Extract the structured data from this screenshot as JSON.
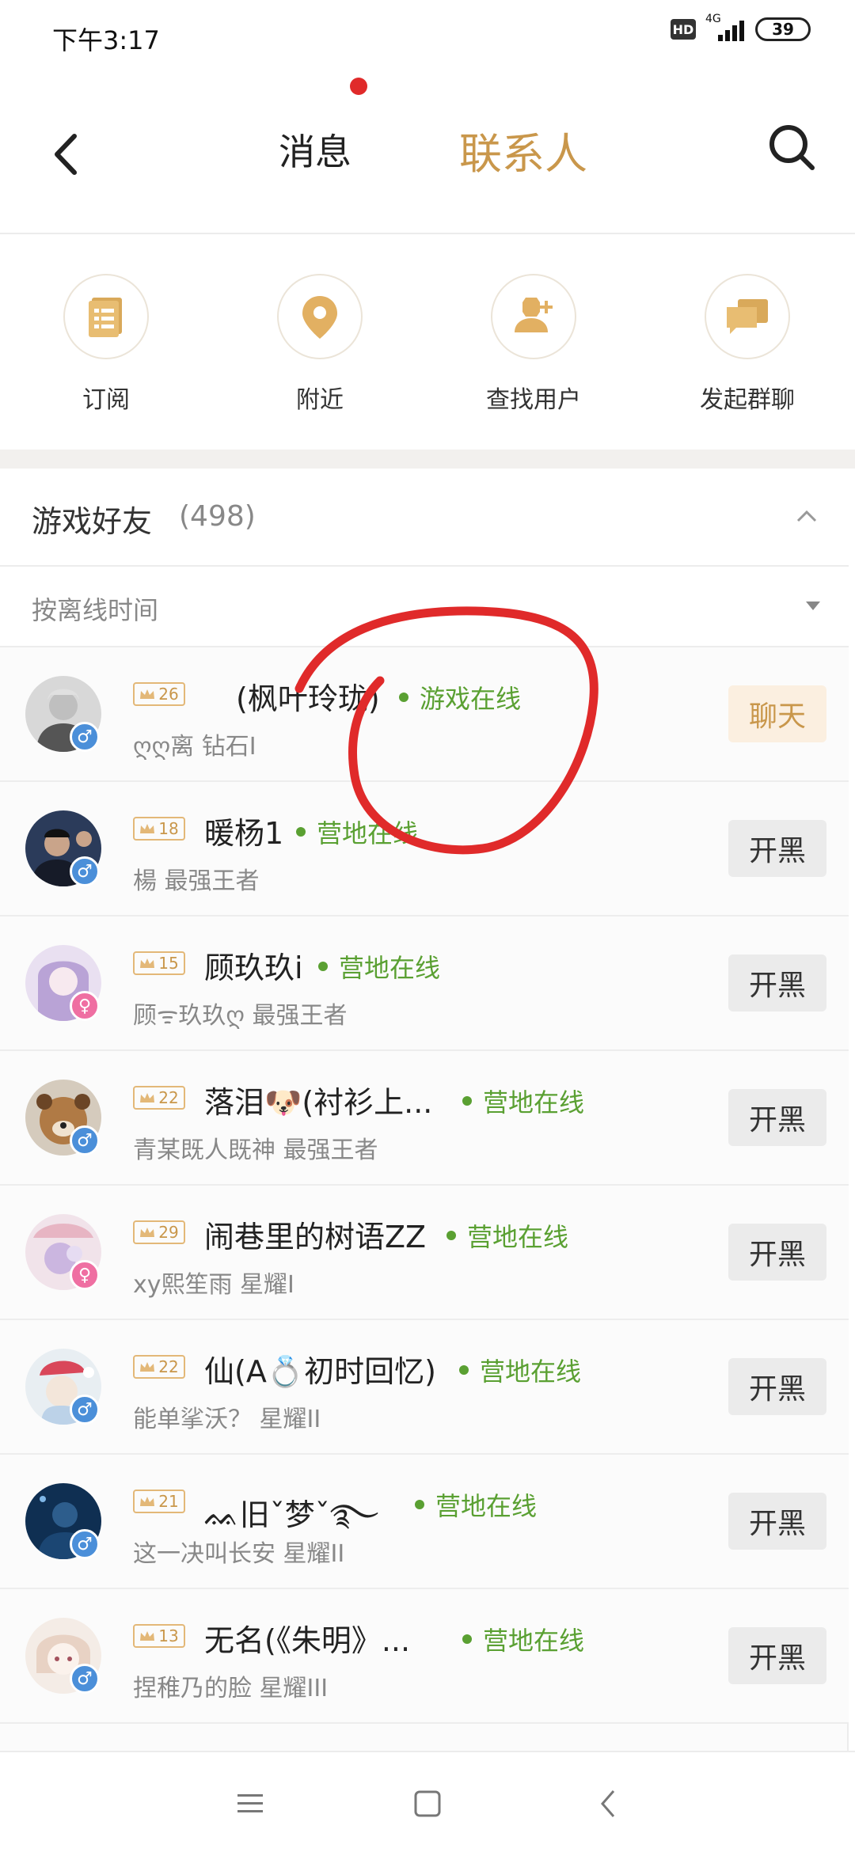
{
  "status_bar": {
    "time": "下午3:17",
    "hd": "HD",
    "network": "4G",
    "battery": "39"
  },
  "header": {
    "tab_messages": "消息",
    "tab_contacts": "联系人",
    "accent_color": "#c9974b"
  },
  "quick_actions": [
    {
      "label": "订阅",
      "icon": "subscribe-list-icon"
    },
    {
      "label": "附近",
      "icon": "location-pin-icon"
    },
    {
      "label": "查找用户",
      "icon": "add-user-icon"
    },
    {
      "label": "发起群聊",
      "icon": "group-chat-icon"
    }
  ],
  "friends_section": {
    "title": "游戏好友",
    "count": "(498)",
    "sort_label": "按离线时间"
  },
  "friends": [
    {
      "level": "26",
      "name": "(枫叶玲珑)",
      "status": "游戏在线",
      "sub": "ღღ离 钻石I",
      "gender": "male",
      "action": "聊天"
    },
    {
      "level": "18",
      "name": "暖杨1",
      "status": "营地在线",
      "sub": "楊 最强王者",
      "gender": "male",
      "action": "开黑"
    },
    {
      "level": "15",
      "name": "顾玖玖i",
      "status": "营地在线",
      "sub": "顾ᯤ玖玖ღ 最强王者",
      "gender": "female",
      "action": "开黑"
    },
    {
      "level": "22",
      "name": "落泪🐶(衬衫上...",
      "status": "营地在线",
      "sub": "青某既人既神 最强王者",
      "gender": "male",
      "action": "开黑"
    },
    {
      "level": "29",
      "name": "闹巷里的树语ZZ",
      "status": "营地在线",
      "sub": "xy熙笙雨 星耀I",
      "gender": "female",
      "action": "开黑"
    },
    {
      "level": "22",
      "name": "仙(A💍初时回忆)",
      "status": "营地在线",
      "sub": "能单挲沃？ 星耀II",
      "gender": "male",
      "action": "开黑"
    },
    {
      "level": "21",
      "name": "ᨐ旧ˇ梦ˇ࿐",
      "status": "营地在线",
      "sub": "这一决叫长安 星耀II",
      "gender": "male",
      "action": "开黑"
    },
    {
      "level": "13",
      "name": "无名(《朱明》...",
      "status": "营地在线",
      "sub": "捏稚乃的脸 星耀III",
      "gender": "male",
      "action": "开黑"
    }
  ],
  "colors": {
    "online_green": "#5aa032",
    "annotation_red": "#e02a2a"
  }
}
